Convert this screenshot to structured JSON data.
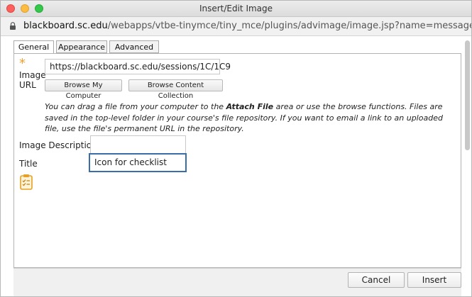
{
  "window": {
    "title": "Insert/Edit Image"
  },
  "address": {
    "host": "blackboard.sc.edu",
    "path": "/webapps/vtbe-tinymce/tiny_mce/plugins/advimage/image.jsp?name=messagetext&strCou..."
  },
  "tabs": [
    {
      "label": "General",
      "active": true
    },
    {
      "label": "Appearance",
      "active": false
    },
    {
      "label": "Advanced",
      "active": false
    }
  ],
  "form": {
    "required_marker": "*",
    "image_url_label_1": "Image",
    "image_url_label_2": "URL",
    "image_url_value": "https://blackboard.sc.edu/sessions/1C/1C9",
    "browse_computer_label": "Browse My Computer",
    "browse_content_label": "Browse Content Collection",
    "help_part1": "You can drag a file from your computer to the ",
    "help_bold": "Attach File",
    "help_part2": " area or use the browse functions. Files are saved in the top-level folder in your course's file repository. If you want to email a link to an uploaded file, use the file's permanent URL in the repository.",
    "description_label": "Image Description",
    "description_value": "",
    "title_label": "Title",
    "title_value": "Icon for checklist",
    "preview_icon": "clipboard-checklist-icon"
  },
  "footer": {
    "cancel_label": "Cancel",
    "insert_label": "Insert"
  }
}
